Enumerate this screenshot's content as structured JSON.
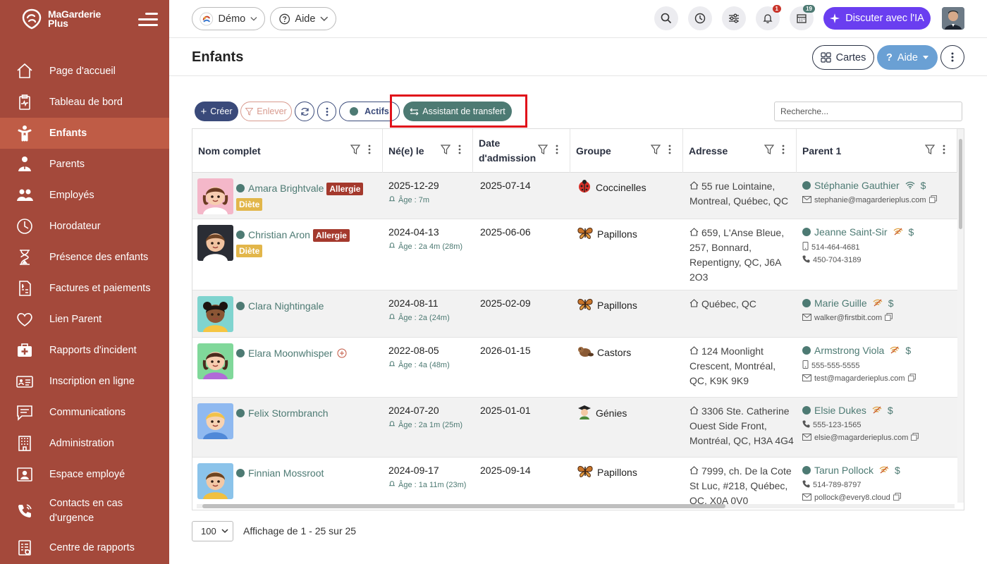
{
  "app": {
    "logo_line1": "MaGarderie",
    "logo_line2": "Plus"
  },
  "sidebar": {
    "items": [
      {
        "label": "Page d'accueil",
        "icon": "home-icon"
      },
      {
        "label": "Tableau de bord",
        "icon": "clipboard-pulse-icon"
      },
      {
        "label": "Enfants",
        "icon": "child-icon",
        "active": true
      },
      {
        "label": "Parents",
        "icon": "parent-icon"
      },
      {
        "label": "Employés",
        "icon": "employees-icon"
      },
      {
        "label": "Horodateur",
        "icon": "clock-icon"
      },
      {
        "label": "Présence des enfants",
        "icon": "hourglass-icon"
      },
      {
        "label": "Factures et paiements",
        "icon": "invoice-icon"
      },
      {
        "label": "Lien Parent",
        "icon": "heart-icon"
      },
      {
        "label": "Rapports d'incident",
        "icon": "first-aid-icon"
      },
      {
        "label": "Inscription en ligne",
        "icon": "id-card-icon"
      },
      {
        "label": "Communications",
        "icon": "chat-icon"
      },
      {
        "label": "Administration",
        "icon": "building-icon"
      },
      {
        "label": "Espace employé",
        "icon": "employee-space-icon"
      },
      {
        "label": "Contacts en cas d'urgence",
        "icon": "phone-icon"
      },
      {
        "label": "Centre de rapports",
        "icon": "report-icon"
      }
    ]
  },
  "topbar": {
    "demo_label": "Démo",
    "help_label": "Aide",
    "notifications_count": "1",
    "calendar_count": "19",
    "ai_label": "Discuter avec l'IA"
  },
  "page": {
    "title": "Enfants",
    "cards_label": "Cartes",
    "help_label": "Aide"
  },
  "toolbar": {
    "create_label": "Créer",
    "remove_label": "Enlever",
    "active_label": "Actifs",
    "transfer_label": "Assistant de transfert",
    "search_placeholder": "Recherche..."
  },
  "table": {
    "columns": [
      "Nom complet",
      "Né(e) le",
      "Date d'admission",
      "Groupe",
      "Adresse",
      "Parent 1"
    ],
    "rows": [
      {
        "name": "Amara Brightvale",
        "allergy": "Allergie",
        "diet": "Diète",
        "birth": "2025-12-29",
        "age": "Âge : 7m",
        "admission": "2025-07-14",
        "group": "Coccinelles",
        "group_icon": "ladybug-icon",
        "address": "55 rue Lointaine, Montreal, Québec, QC",
        "parent": "Stéphanie Gauthier",
        "parent_icon": "wifi-icon",
        "lines": [
          {
            "icon": "email-icon",
            "text": "stephanie@magarderieplus.com",
            "copy": true
          }
        ]
      },
      {
        "name": "Christian Aron",
        "allergy": "Allergie",
        "diet": "Diète",
        "birth": "2024-04-13",
        "age": "Âge : 2a 4m (28m)",
        "admission": "2025-06-06",
        "group": "Papillons",
        "group_icon": "butterfly-icon",
        "address": "659, L'Anse Bleue, 257, Bonnard, Repentigny, QC, J6A 2O3",
        "parent": "Jeanne Saint-Sir",
        "parent_icon": "wifi-off-icon",
        "lines": [
          {
            "icon": "mobile-icon",
            "text": "514-464-4681"
          },
          {
            "icon": "phone-icon",
            "text": "450-704-3189"
          }
        ]
      },
      {
        "name": "Clara Nightingale",
        "allergy": "",
        "diet": "",
        "birth": "2024-08-11",
        "age": "Âge : 2a (24m)",
        "admission": "2025-02-09",
        "group": "Papillons",
        "group_icon": "butterfly-icon",
        "address": "Québec, QC",
        "parent": "Marie Guille",
        "parent_icon": "wifi-off-icon",
        "lines": [
          {
            "icon": "email-icon",
            "text": "walker@firstbit.com",
            "copy": true
          }
        ]
      },
      {
        "name": "Elara Moonwhisper",
        "allergy": "",
        "diet": "",
        "plus": true,
        "birth": "2022-08-05",
        "age": "Âge : 4a (48m)",
        "admission": "2026-01-15",
        "group": "Castors",
        "group_icon": "beaver-icon",
        "address": "124 Moonlight Crescent, Montréal, QC, K9K 9K9",
        "parent": "Armstrong Viola",
        "parent_icon": "wifi-off-icon",
        "lines": [
          {
            "icon": "mobile-icon",
            "text": "555-555-5555"
          },
          {
            "icon": "email-icon",
            "text": "test@magarderieplus.com",
            "copy": true
          }
        ]
      },
      {
        "name": "Felix Stormbranch",
        "allergy": "",
        "diet": "",
        "birth": "2024-07-20",
        "age": "Âge : 2a 1m (25m)",
        "admission": "2025-01-01",
        "group": "Génies",
        "group_icon": "graduate-icon",
        "address": "3306 Ste. Catherine Ouest Side Front, Montréal, QC, H3A 4G4",
        "parent": "Elsie Dukes",
        "parent_icon": "wifi-off-icon",
        "lines": [
          {
            "icon": "phone-icon",
            "text": "555-123-1565"
          },
          {
            "icon": "email-icon",
            "text": "elsie@magarderieplus.com",
            "copy": true
          }
        ]
      },
      {
        "name": "Finnian Mossroot",
        "allergy": "",
        "diet": "",
        "birth": "2024-09-17",
        "age": "Âge : 1a 11m (23m)",
        "admission": "2025-09-14",
        "group": "Papillons",
        "group_icon": "butterfly-icon",
        "address": "7999, ch. De la Cote St Luc, #218, Québec, QC, X0A 0V0",
        "parent": "Tarun Pollock",
        "parent_icon": "wifi-off-icon",
        "lines": [
          {
            "icon": "phone-icon",
            "text": "514-789-8797"
          },
          {
            "icon": "email-icon",
            "text": "pollock@every8.cloud",
            "copy": true
          }
        ]
      }
    ]
  },
  "footer": {
    "page_size": "100",
    "info": "Affichage de 1 - 25 sur 25"
  },
  "colors": {
    "sidebar": "#a4493b",
    "sidebar_active": "#bf5c46",
    "accent": "#4d7a73",
    "primary": "#3a4a7a",
    "ai": "#6a3ef0"
  }
}
